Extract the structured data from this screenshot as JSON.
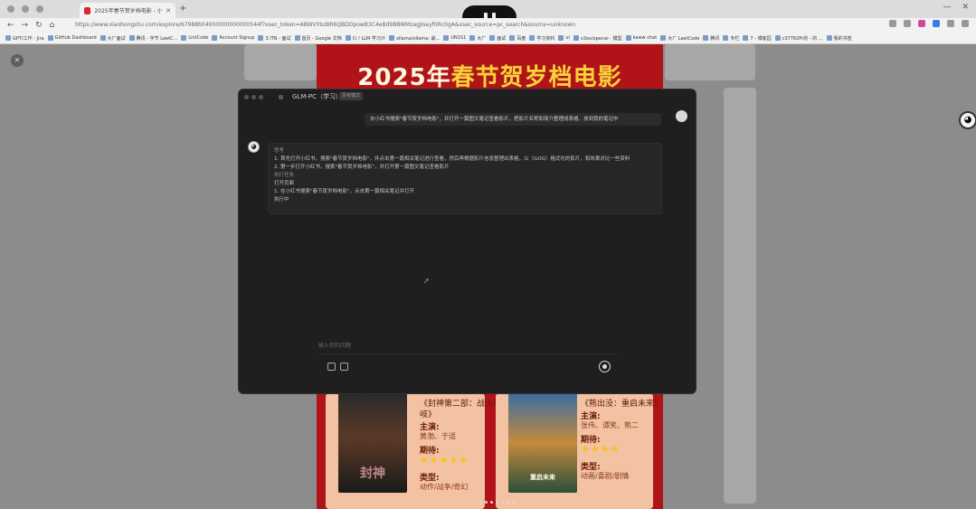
{
  "browser": {
    "tab_title": "2025年春节贺岁档电影 - 小红书",
    "url": "https://www.xiaohongshu.com/explore/67988b04000000000000544f?xsec_token=ABWVYbzBR6QBDDpowB3C4eBd9BBWMzagJlseyf0Rc0gA&xsec_source=pc_search&source=unknown",
    "bookmarks": [
      "GPT/工作 - Jira",
      "GitHub Dashboard",
      "大厂面试",
      "腾讯 - 字节 LeetC...",
      "LintCode",
      "Account Signup",
      "3 ITN - 面试",
      "首页 - Google 文档",
      "Ci / LLM 学习计",
      "ollama/ollama: 最...",
      "UN1S1",
      "大厂",
      "面试",
      "百度",
      "学习资料",
      "ui",
      "v2ex/openai - 模型",
      "kaww chat",
      "大厂 LeetCode",
      "腾讯",
      "专栏",
      "7 - 博客园",
      "c37782Pr的 - 的 ...",
      "我的书签"
    ]
  },
  "poster": {
    "title_white_1": "2025年",
    "title_yellow": "春节贺岁档电影",
    "movies": [
      {
        "title": "《封神第二部：战火西岐》",
        "lead_label": "主演:",
        "lead_value": "黄渤、于适",
        "rating_label": "期待:",
        "stars": "★★★★★",
        "genre_label": "类型:",
        "genre_value": "动作/战争/奇幻",
        "poster_mark": "封神"
      },
      {
        "title": "《熊出没：重启未来》",
        "lead_label": "主演:",
        "lead_value": "张伟、谭笑、熊二",
        "rating_label": "期待:",
        "stars": "★★★★",
        "genre_label": "类型:",
        "genre_value": "动画/喜剧/剧情",
        "poster_mark": "重启未来"
      }
    ]
  },
  "chat": {
    "title": "GLM-PC（学习）",
    "badge": "思考模式",
    "user_message": "去小红书搜索\"春节贺岁档电影\"，并打开一篇图文笔记查看影片，把影片名称和简介整理成表格，放到我的笔记中",
    "bot_lines": [
      {
        "text": "思考",
        "dim": true
      },
      {
        "text": "1. 首先打开小红书，搜索\"春节贺岁档电影\"，并点击第一篇相关笔记进行查看，然后再根据影片信息整理出表格，以（GOG）格式化的影片，和效果对比一些资料",
        "dim": false
      },
      {
        "text": "2. 第一步打开小红书，搜索\"春节贺岁档电影\"，并打开第一篇图文笔记查看影片",
        "dim": false
      },
      {
        "text": "执行任务",
        "dim": true
      },
      {
        "text": "打开页面",
        "dim": false
      },
      {
        "text": "1. 在小红书搜索\"春节贺岁档电影\"，点击第一篇相关笔记并打开",
        "dim": false
      },
      {
        "text": "",
        "dim": false
      },
      {
        "text": "执行中",
        "dim": false
      }
    ],
    "input_placeholder": "输入你的问题"
  }
}
